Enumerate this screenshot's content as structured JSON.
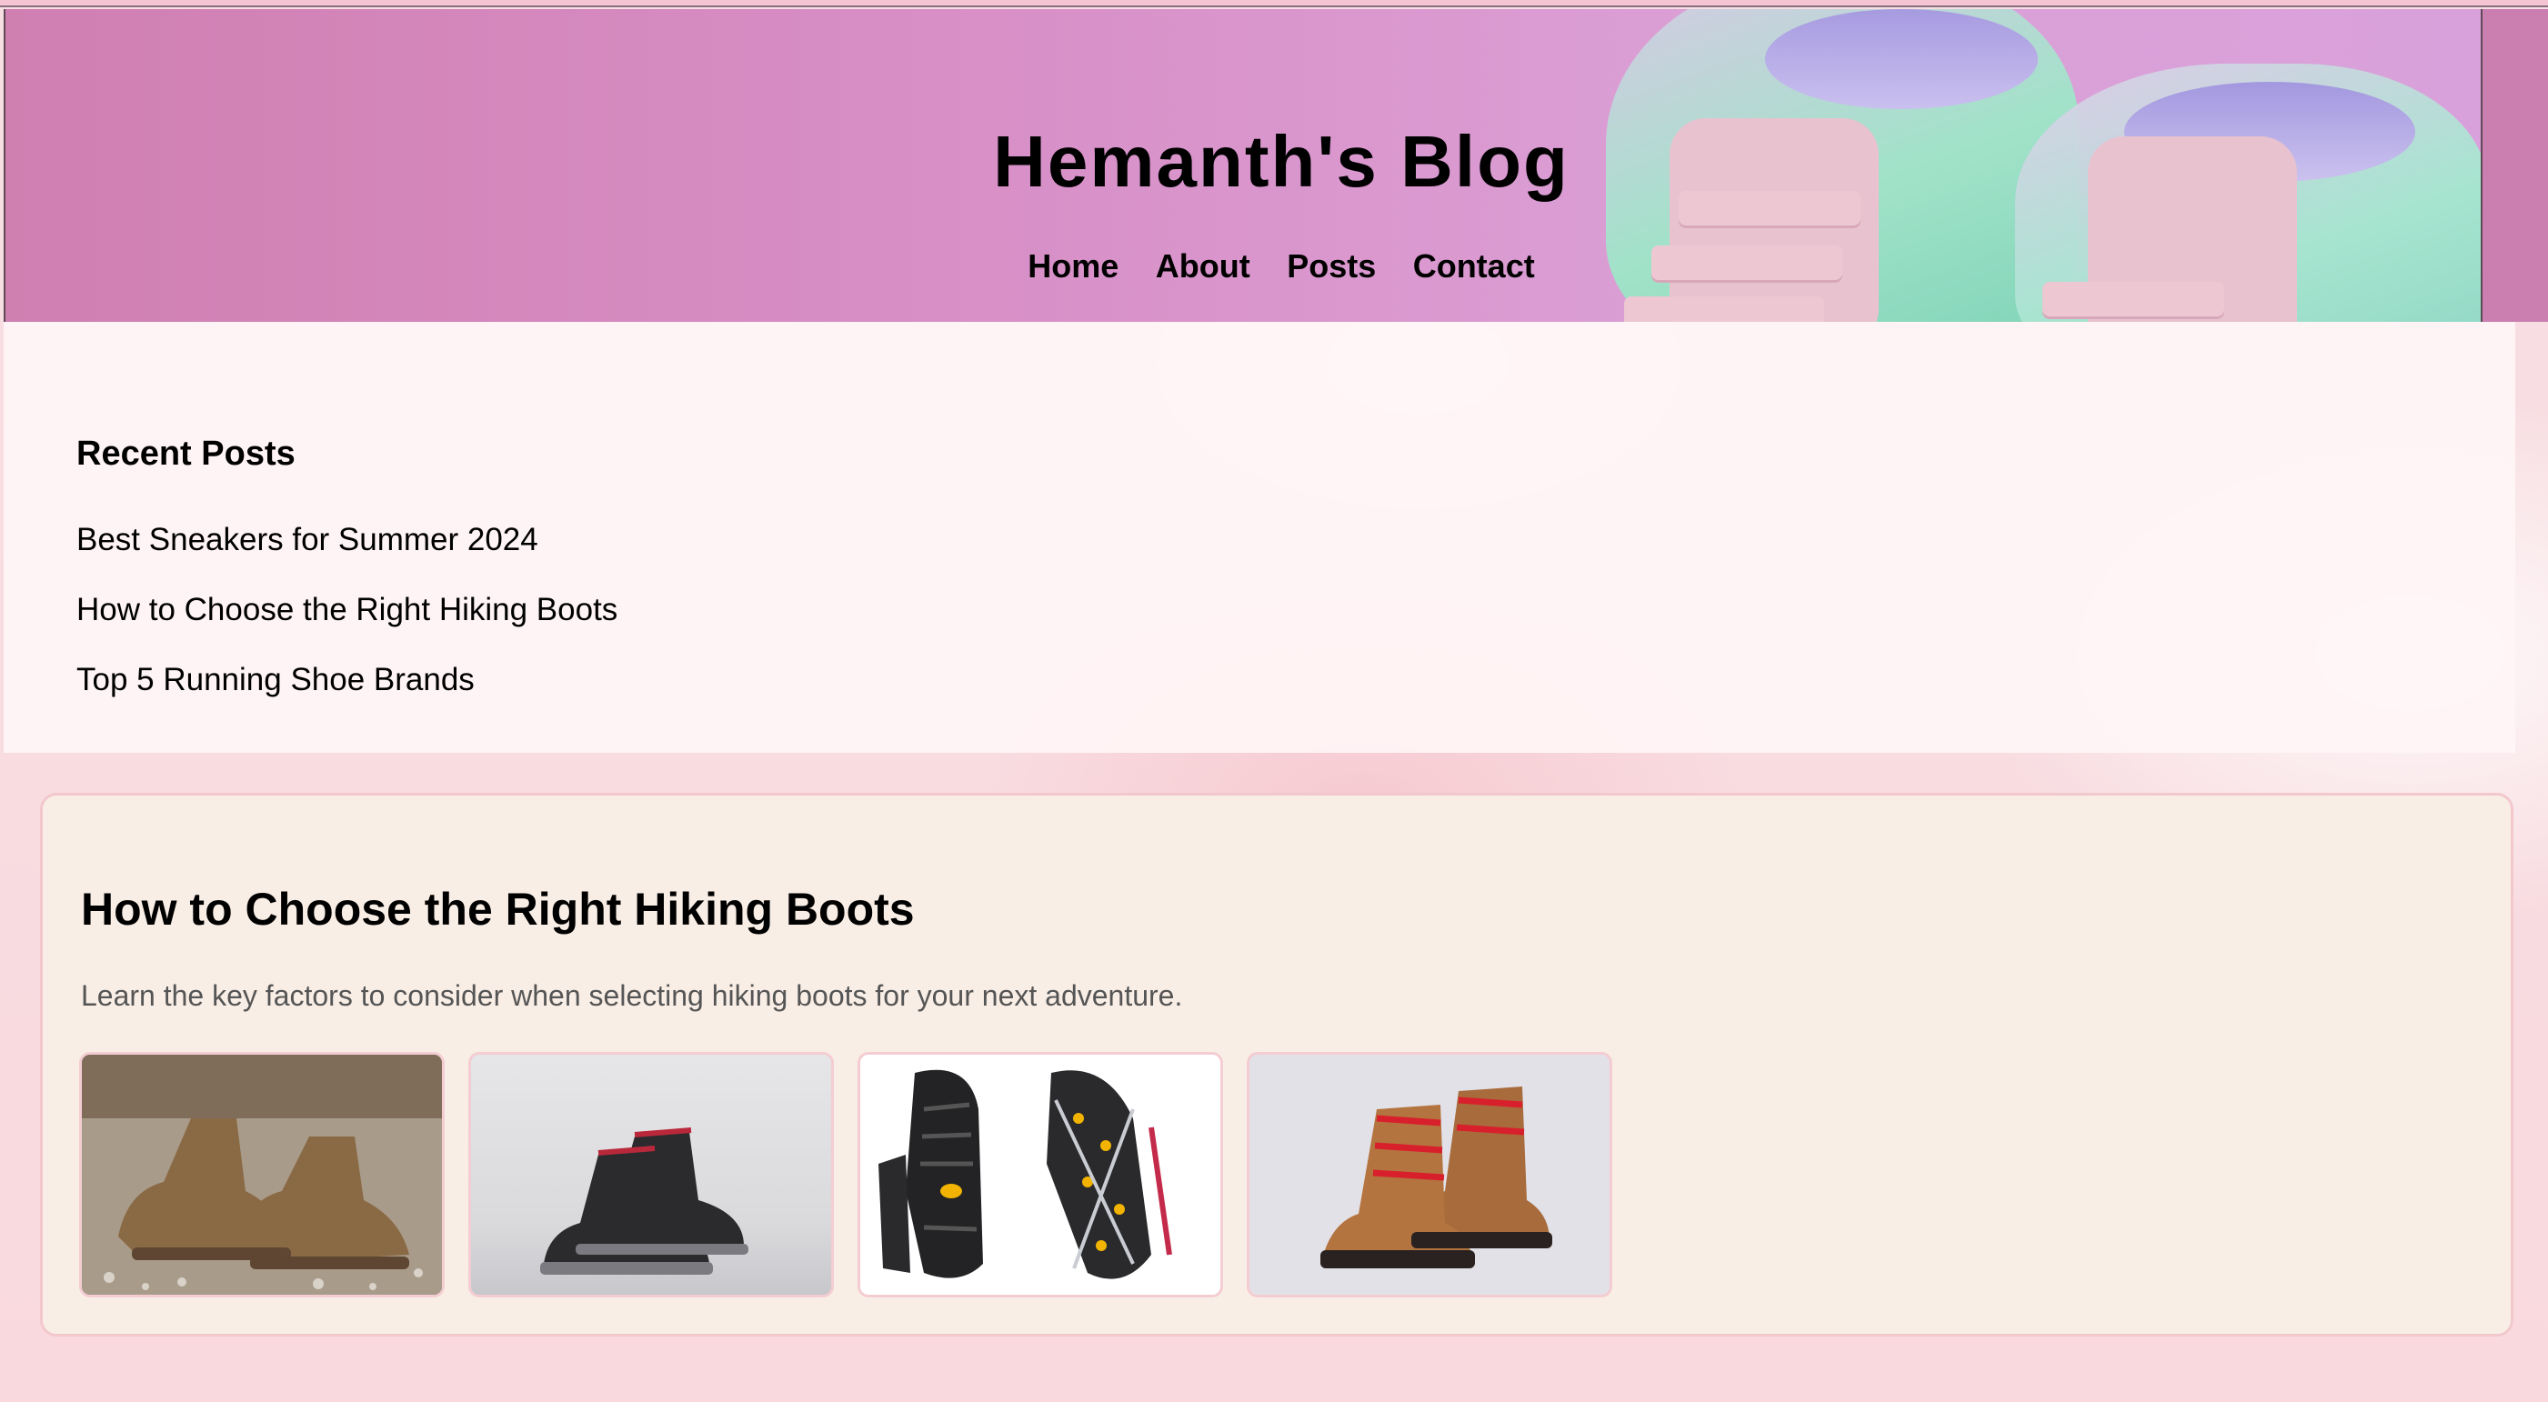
{
  "header": {
    "title": "Hemanth's Blog",
    "nav": [
      {
        "label": "Home"
      },
      {
        "label": "About"
      },
      {
        "label": "Posts"
      },
      {
        "label": "Contact"
      }
    ]
  },
  "recent_posts": {
    "heading": "Recent Posts",
    "items": [
      {
        "label": "Best Sneakers for Summer 2024"
      },
      {
        "label": "How to Choose the Right Hiking Boots"
      },
      {
        "label": "Top 5 Running Shoe Brands"
      }
    ]
  },
  "post": {
    "title": "How to Choose the Right Hiking Boots",
    "excerpt": "Learn the key factors to consider when selecting hiking boots for your next adventure.",
    "images": [
      {
        "name": "hiking-boots-on-gravel-image"
      },
      {
        "name": "black-work-boots-image"
      },
      {
        "name": "boot-soles-with-crampons-image"
      },
      {
        "name": "brown-boots-red-laces-image"
      }
    ]
  },
  "colors": {
    "header_start": "#d07fb1",
    "header_end": "#d9a1db",
    "card_bg": "#f9eee6",
    "card_border": "#f2c8cd"
  }
}
